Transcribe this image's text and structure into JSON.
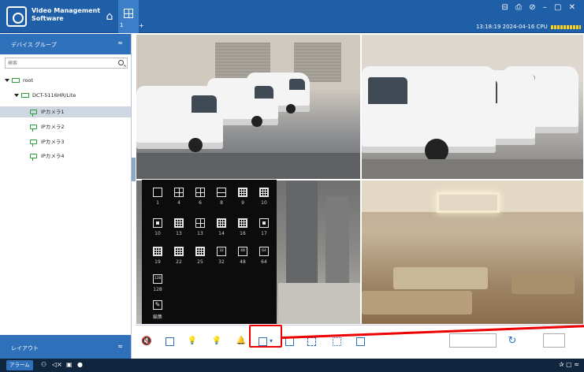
{
  "app": {
    "title": "Video Management\nSoftware",
    "tab_number": "1",
    "tab_plus": "+",
    "window_icons": "⊟ ⎙ ⊘ – ▢ ✕",
    "status_time": "13:18:19 2024-04-16 CPU",
    "accent": "#1f5fa8"
  },
  "sidebar": {
    "header": "デバイス グループ",
    "header_chevron": "≈",
    "search_placeholder": "検索",
    "tree": {
      "root": "root",
      "device": "DCT-5116HR/Lite",
      "cameras": [
        "IPカメラ1",
        "IPカメラ2",
        "IPカメラ3",
        "IPカメラ4"
      ]
    },
    "footer": "レイアウト",
    "footer_chevron": "≈"
  },
  "layout_popup": {
    "rows": [
      [
        "1",
        "4",
        "6",
        "8",
        "9",
        "10"
      ],
      [
        "10",
        "13",
        "13",
        "14",
        "16",
        "17"
      ],
      [
        "19",
        "22",
        "25",
        "32",
        "48",
        "64"
      ],
      [
        "128"
      ]
    ],
    "edit_label": "編集",
    "icon_text": {
      "32": "32",
      "48": "48",
      "64": "64",
      "128": "128"
    }
  },
  "toolbar": {
    "mute": "🔇",
    "window_mode": "▢",
    "bulb1": "💡",
    "bulb2": "💡",
    "alarm": "🔔",
    "layout_dropdown": "▾",
    "refresh": "↻"
  },
  "statusbar": {
    "alarm_label": "アラーム",
    "right_icons": "✰ ▢ ≈"
  }
}
